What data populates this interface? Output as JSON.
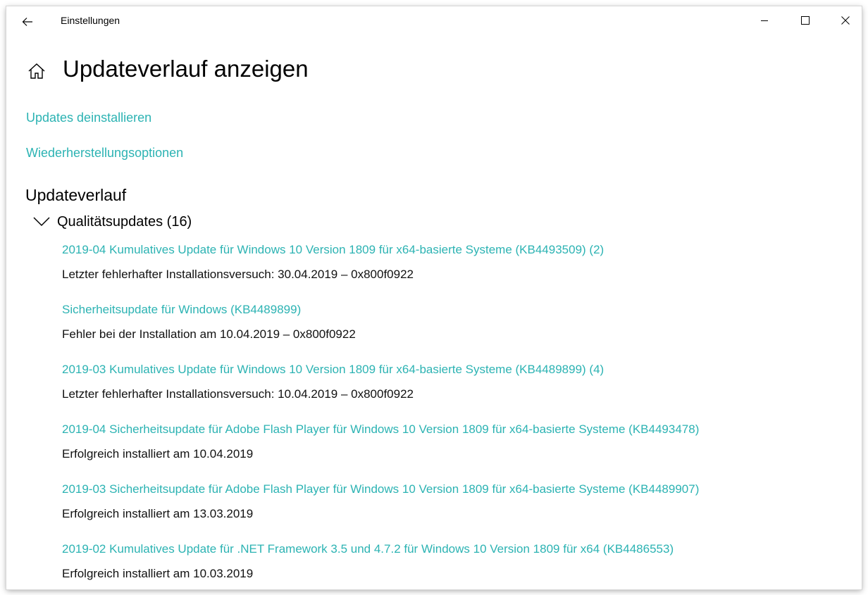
{
  "window": {
    "title": "Einstellungen"
  },
  "page": {
    "title": "Updateverlauf anzeigen"
  },
  "links": {
    "uninstall": "Updates deinstallieren",
    "recovery": "Wiederherstellungsoptionen"
  },
  "history": {
    "title": "Updateverlauf",
    "group_label": "Qualitätsupdates (16)",
    "items": [
      {
        "name": "2019-04 Kumulatives Update für Windows 10 Version 1809 für x64-basierte Systeme (KB4493509) (2)",
        "status": "Letzter fehlerhafter Installationsversuch: 30.04.2019 – 0x800f0922"
      },
      {
        "name": "Sicherheitsupdate für Windows (KB4489899)",
        "status": "Fehler bei der Installation am 10.04.2019 – 0x800f0922"
      },
      {
        "name": "2019-03 Kumulatives Update für Windows 10 Version 1809 für x64-basierte Systeme (KB4489899) (4)",
        "status": "Letzter fehlerhafter Installationsversuch: 10.04.2019 – 0x800f0922"
      },
      {
        "name": "2019-04 Sicherheitsupdate für Adobe Flash Player für Windows 10 Version 1809 für x64-basierte Systeme (KB4493478)",
        "status": "Erfolgreich installiert am 10.04.2019"
      },
      {
        "name": "2019-03 Sicherheitsupdate für Adobe Flash Player für Windows 10 Version 1809 für x64-basierte Systeme (KB4489907)",
        "status": "Erfolgreich installiert am 13.03.2019"
      },
      {
        "name": "2019-02 Kumulatives Update für .NET Framework 3.5 und 4.7.2 für Windows 10 Version 1809 für x64 (KB4486553)",
        "status": "Erfolgreich installiert am 10.03.2019"
      }
    ]
  },
  "icons": {
    "back": "back-arrow-icon",
    "minimize": "minimize-icon",
    "maximize": "maximize-icon",
    "close": "close-icon",
    "home": "home-icon",
    "chevron": "chevron-down-icon"
  },
  "colors": {
    "accent": "#2cb3b3"
  }
}
